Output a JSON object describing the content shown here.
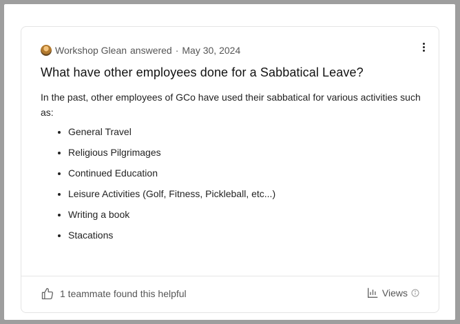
{
  "answer": {
    "author": "Workshop Glean",
    "action": "answered",
    "separator": "·",
    "date": "May 30, 2024",
    "question": "What have other employees done for a Sabbatical Leave?",
    "intro": "In the past, other employees of GCo have used their sabbatical for various activities such as:",
    "items": [
      "General Travel",
      "Religious Pilgrimages",
      "Continued Education",
      "Leisure Activities (Golf, Fitness, Pickleball, etc...)",
      "Writing a book",
      "Stacations"
    ]
  },
  "footer": {
    "helpful_text": "1 teammate found this helpful",
    "views_label": "Views"
  },
  "icons": {
    "avatar": "user-avatar",
    "menu": "more-vertical-icon",
    "thumbs": "thumbs-up-icon",
    "chart": "bar-chart-icon",
    "info": "info-icon"
  }
}
